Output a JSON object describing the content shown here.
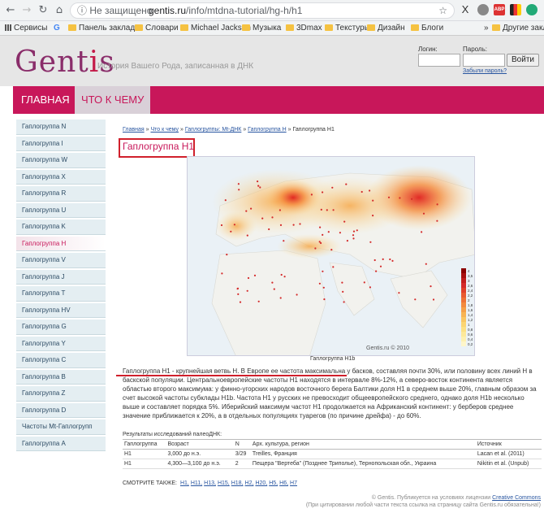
{
  "browser": {
    "back": "←",
    "forward": "→",
    "reload": "↻",
    "home": "⌂",
    "security": "ⓘ Не защищено",
    "url_prefix": "gentis.ru",
    "url_path": "/info/mtdna-tutorial/hg-h/h1",
    "star": "☆",
    "ext_abp": "ABP",
    "bookmarks": [
      "Сервисы",
      "Панель закладок",
      "Словари",
      "Michael Jackson",
      "Музыка",
      "3Dmax",
      "Текстуры",
      "Дизайн",
      "Блоги"
    ],
    "other_bookmarks": "Другие закл",
    "more": "»"
  },
  "site": {
    "logo_a": "Gent",
    "logo_i": "i",
    "logo_b": "s",
    "tagline": "История Вашего Рода, записанная в ДНК",
    "login_label": "Логин:",
    "password_label": "Пароль:",
    "login_button": "Войти",
    "forgot": "Забыли пароль?",
    "menu_home": "Главная",
    "menu_what": "Что к чему"
  },
  "sidebar": [
    "Гаплогруппа N",
    "Гаплогруппа I",
    "Гаплогруппа W",
    "Гаплогруппа X",
    "Гаплогруппа R",
    "Гаплогруппа U",
    "Гаплогруппа K",
    "Гаплогруппа H",
    "Гаплогруппа V",
    "Гаплогруппа J",
    "Гаплогруппа T",
    "Гаплогруппа HV",
    "Гаплогруппа G",
    "Гаплогруппа Y",
    "Гаплогруппа C",
    "Гаплогруппа B",
    "Гаплогруппа Z",
    "Гаплогруппа D",
    "Частоты Mt-Гаплогрупп",
    "Гаплогруппа A"
  ],
  "sidebar_active_index": 7,
  "crumbs": {
    "home": "Главная",
    "sep": "»",
    "what": "Что к чему",
    "groups": "Гаплогруппы: Mt-ДНК",
    "h": "Гаплогруппа H",
    "current": "Гаплогруппа H1"
  },
  "page_title": "Гаплогруппа H1",
  "map": {
    "credit": "Gentis.ru © 2010",
    "caption": "Гаплогруппа H1b",
    "legend": [
      "4",
      "3,5",
      "3",
      "2,6",
      "2,4",
      "2,2",
      "2",
      "1,8",
      "1,6",
      "1,4",
      "1,2",
      "1",
      "0,8",
      "0,6",
      "0,4",
      "0,2"
    ],
    "watermark": "gentis.ru"
  },
  "description": "Гаплогруппа H1 - крупнейшая ветвь H. В Европе ее частота максимальна у басков, составляя почти 30%, или половину всех линий H в баскской популяции. Центральноевропейские частоты H1 находятся в интервале 8%-12%, а северо-восток континента является областью второго максимума: у финно-угорских народов восточного берега Балтики доля H1 в среднем выше 20%, главным образом за счет высокой частоты субклады H1b. Частота H1 у русских не превосходит общеевропейского среднего, однако доля H1b несколько выше и составляет порядка 5%. Иберийский максимум частот H1 продолжается на Африканский континент: у берберов среднее значение приближается к 20%, а в отдельных популяциях туарегов (по причине дрейфа) - до 60%.",
  "results": {
    "title": "Результаты исследований палеоДНК:",
    "headers": [
      "Гаплогруппа",
      "Возраст",
      "N",
      "Арх. культура, регион",
      "Источник"
    ],
    "rows": [
      [
        "H1",
        "3,000 до н.э.",
        "3/29",
        "Treilles, Франция",
        "Lacan et al. (2011)"
      ],
      [
        "H1",
        "4,300—3,100 до н.э.",
        "2",
        "Пещера \"Вертеба\" (Позднее Триполье), Тернопольская обл., Украина",
        "Nikitin et al. (Unpub)"
      ]
    ]
  },
  "see_also": {
    "label": "СМОТРИТЕ ТАКЖЕ:",
    "links": [
      "H1,",
      "H11,",
      "H13,",
      "H15,",
      "H18,",
      "H2,",
      "H20,",
      "H5,",
      "H6,",
      "H7"
    ]
  },
  "footer": {
    "line1_a": "© Gentis. Публикуется на условиях лицензии ",
    "line1_link": "Creative Commons",
    "line2": "(При цитировании любой части текста ссылка на страницу сайта Gentis.ru обязательна!)"
  },
  "colors": {
    "brand": "#c8175a",
    "link": "#2855a0",
    "sidebar_bg": "#e4eef2"
  }
}
